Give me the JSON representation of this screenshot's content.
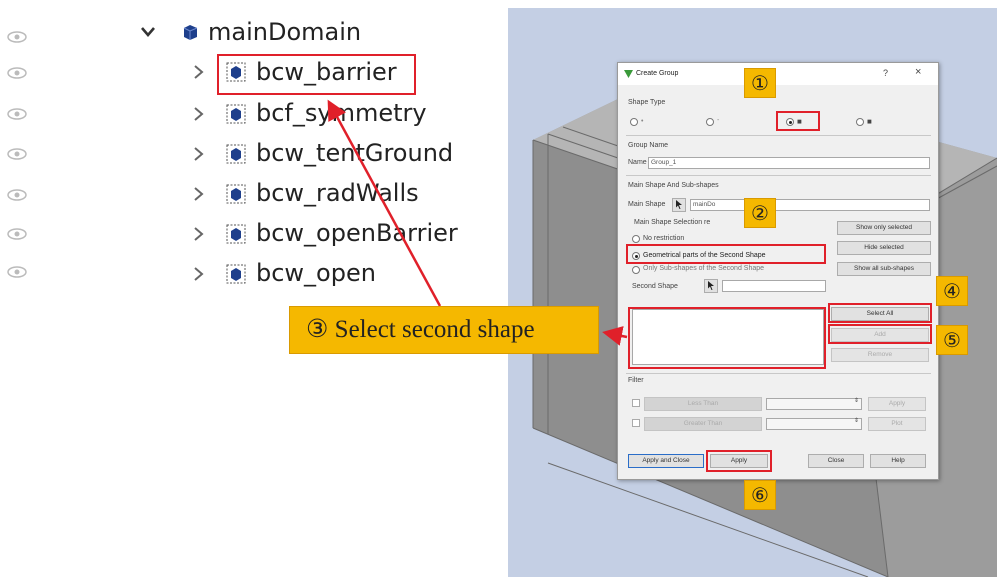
{
  "tree": {
    "root": {
      "label": "mainDomain"
    },
    "items": [
      {
        "label": "bcw_barrier"
      },
      {
        "label": "bcf_symmetry"
      },
      {
        "label": "bcw_tentGround"
      },
      {
        "label": "bcw_radWalls"
      },
      {
        "label": "bcw_openBarrier"
      },
      {
        "label": "bcw_open"
      }
    ]
  },
  "dialog": {
    "title": "Create Group",
    "help_glyph": "?",
    "close_glyph": "×",
    "shape_type_label": "Shape Type",
    "group_name_label": "Group Name",
    "name_label": "Name",
    "name_value": "Group_1",
    "main_shape_section": "Main Shape And Sub-shapes",
    "main_shape_label": "Main Shape",
    "main_shape_value": "mainDo",
    "selection_restriction_label": "Main Shape Selection re",
    "restriction_options": [
      {
        "label": "No restriction",
        "checked": false
      },
      {
        "label": "Geometrical parts of the Second Shape",
        "checked": true
      },
      {
        "label": "Only Sub-shapes of the Second Shape",
        "checked": false
      }
    ],
    "show_only_selected": "Show only selected",
    "hide_selected": "Hide selected",
    "show_all_sub_shapes": "Show all sub-shapes",
    "second_shape_label": "Second Shape",
    "select_all": "Select All",
    "add": "Add",
    "remove": "Remove",
    "filter_label": "Filter",
    "less_than": "Less Than",
    "greater_than": "Greater Than",
    "filter_apply": "Apply",
    "filter_plot": "Plot",
    "apply_and_close": "Apply and Close",
    "apply": "Apply",
    "close": "Close",
    "help": "Help"
  },
  "annotations": {
    "callout_text": "③ Select second shape",
    "markers": [
      "①",
      "②",
      "④",
      "⑤",
      "⑥"
    ]
  },
  "colors": {
    "highlight_red": "#e0202a",
    "callout_yellow": "#f5b800",
    "viewport_blue": "#c4cfe4"
  }
}
